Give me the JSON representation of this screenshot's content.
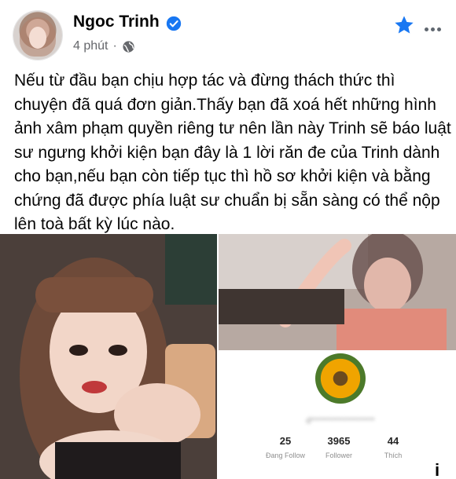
{
  "post": {
    "author_name": "Ngoc Trinh",
    "time": "4 phút",
    "separator": "·",
    "content": "Nếu từ đầu bạn chịu hợp tác và đừng thách thức thì chuyện đã quá đơn giản.Thấy bạn đã xoá hết những hình ảnh xâm phạm quyền riêng tư nên lần này Trinh sẽ báo luật sư ngưng khởi kiện bạn đây là 1 lời răn đe của Trinh dành cho bạn,nếu bạn còn tiếp tục thì hồ sơ khởi kiện và bằng chứng đã được phía luật sư chuẩn bị sẵn sàng có thể nộp lên toà bất kỳ lúc nào."
  },
  "icons": {
    "verified": "verified-badge",
    "privacy": "globe-icon",
    "favorite": "star-icon",
    "more": "more-icon",
    "info": "info-icon"
  },
  "colors": {
    "accent": "#1877f2",
    "meta": "#65676b"
  },
  "instagram": {
    "username": "d*******************",
    "stats": [
      {
        "value": "25",
        "label": "Đang Follow"
      },
      {
        "value": "3965",
        "label": "Follower"
      },
      {
        "value": "44",
        "label": "Thích"
      }
    ]
  },
  "info_label": "i"
}
